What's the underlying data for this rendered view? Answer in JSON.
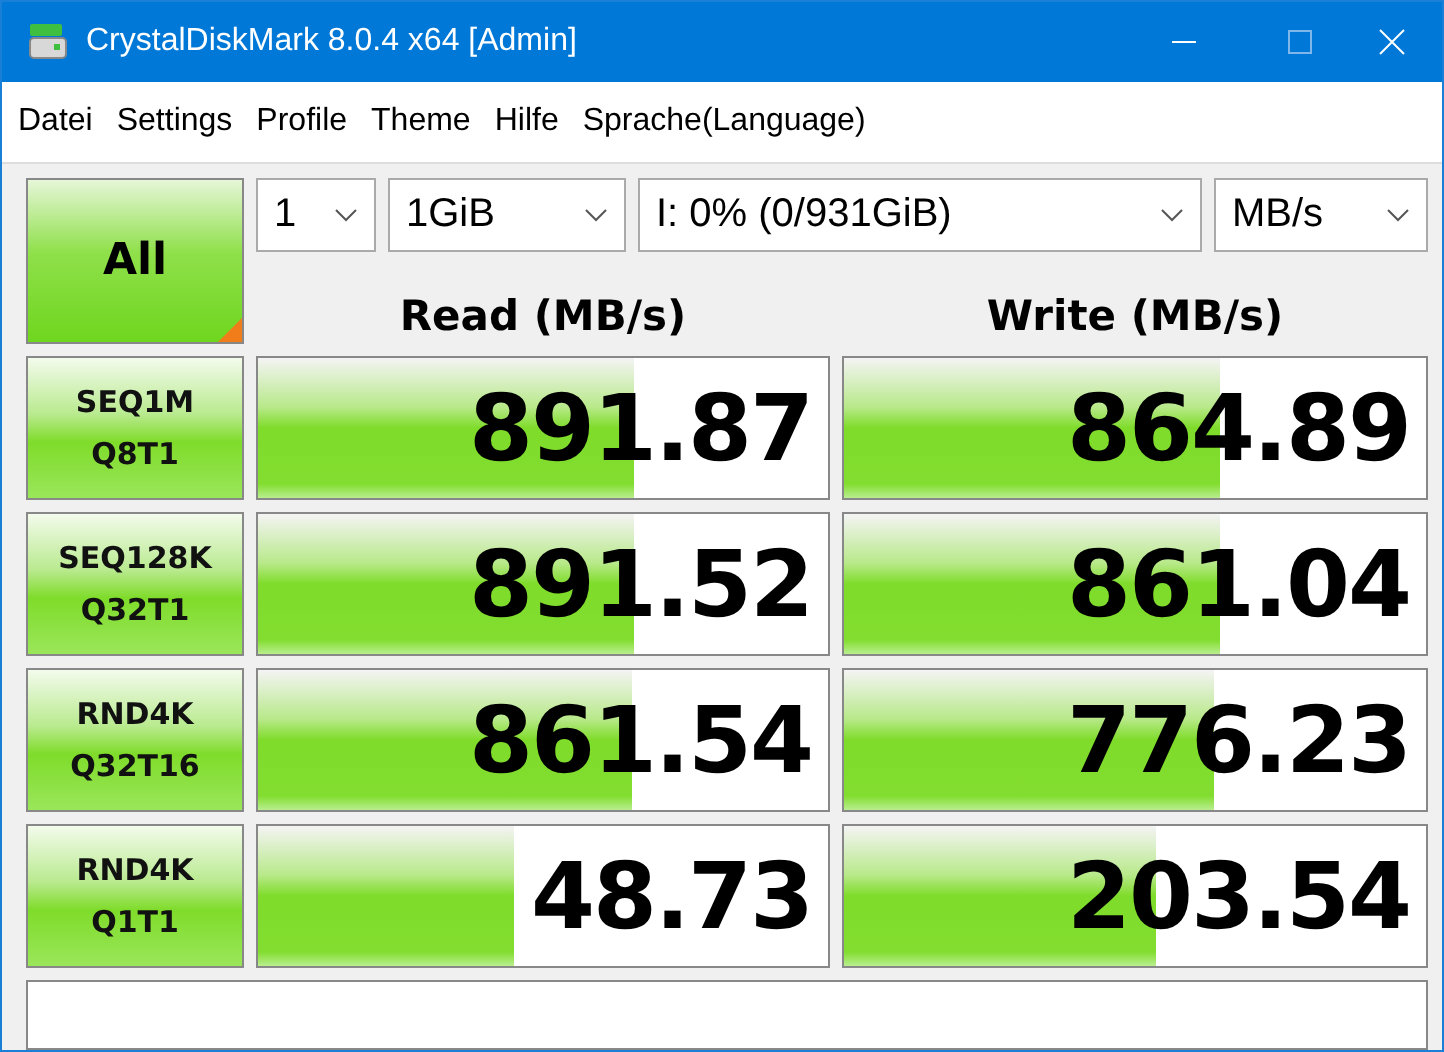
{
  "window": {
    "title": "CrystalDiskMark 8.0.4 x64 [Admin]"
  },
  "menu": [
    "Datei",
    "Settings",
    "Profile",
    "Theme",
    "Hilfe",
    "Sprache(Language)"
  ],
  "all_button": {
    "label": "All"
  },
  "selectors": [
    {
      "value": "1"
    },
    {
      "value": "1GiB"
    },
    {
      "value": "I: 0% (0/931GiB)"
    },
    {
      "value": "MB/s"
    }
  ],
  "headers": [
    "Read (MB/s)",
    "Write (MB/s)"
  ],
  "tests": [
    {
      "label": [
        "SEQ1M",
        "Q8T1"
      ],
      "read": {
        "value": "891.87",
        "level": 0.66
      },
      "write": {
        "value": "864.89",
        "level": 0.645
      }
    },
    {
      "label": [
        "SEQ128K",
        "Q32T1"
      ],
      "read": {
        "value": "891.52",
        "level": 0.66
      },
      "write": {
        "value": "861.04",
        "level": 0.645
      }
    },
    {
      "label": [
        "RND4K",
        "Q32T16"
      ],
      "read": {
        "value": "861.54",
        "level": 0.655
      },
      "write": {
        "value": "776.23",
        "level": 0.635
      }
    },
    {
      "label": [
        "RND4K",
        "Q1T1"
      ],
      "read": {
        "value": "48.73",
        "level": 0.45
      },
      "write": {
        "value": "203.54",
        "level": 0.536
      }
    }
  ]
}
